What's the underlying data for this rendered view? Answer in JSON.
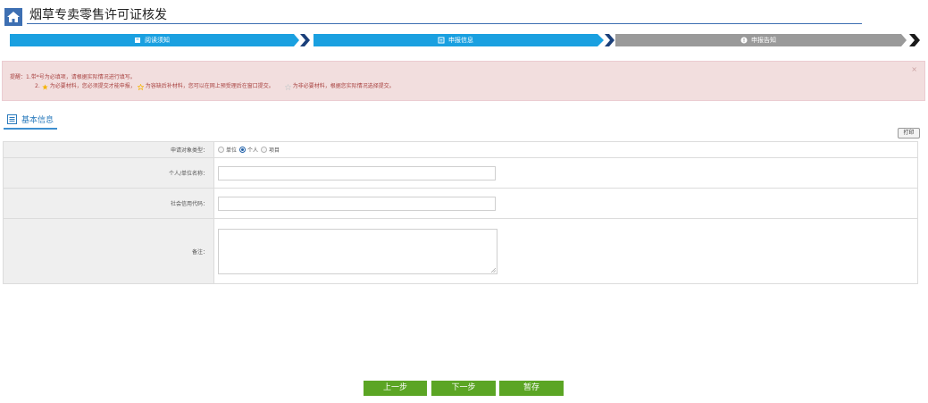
{
  "header": {
    "title": "烟草专卖零售许可证核发",
    "home_icon": "home-icon"
  },
  "steps": [
    {
      "label": "阅读须知",
      "icon": "book-icon",
      "state": "done",
      "color": "#1aa0e0"
    },
    {
      "label": "申报信息",
      "icon": "form-icon",
      "state": "current",
      "color": "#1aa0e0"
    },
    {
      "label": "申报告知",
      "icon": "info-icon",
      "state": "pending",
      "color": "#9a9a9a"
    }
  ],
  "alert": {
    "line1": "提醒：1.带*号为必填项，请根据实际情况进行填写。",
    "line2_a": "2.",
    "line2_b": "为必要材料，您必须提交才能申报，",
    "line2_c": "为容缺后补材料，您可以在网上预受理后在窗口提交。",
    "line2_d": "为非必要材料，根据您实际情况选择提交。",
    "close": "×"
  },
  "section": {
    "title": "基本信息"
  },
  "print_label": "打印",
  "form": {
    "applicant_type": {
      "label": "申请对象类型：",
      "options": [
        "单位",
        "个人",
        "项目"
      ],
      "selected": "个人"
    },
    "name": {
      "label": "个人/单位名称：",
      "value": ""
    },
    "credit_code": {
      "label": "社会信用代码：",
      "value": ""
    },
    "remark": {
      "label": "备注：",
      "value": ""
    }
  },
  "buttons": {
    "prev": "上一步",
    "next": "下一步",
    "save": "暂存"
  },
  "colors": {
    "brand": "#3d6fb2",
    "step_active": "#1aa0e0",
    "step_pending": "#9a9a9a",
    "button": "#5ba524",
    "alert_bg": "#f2dede",
    "alert_text": "#a94442"
  }
}
